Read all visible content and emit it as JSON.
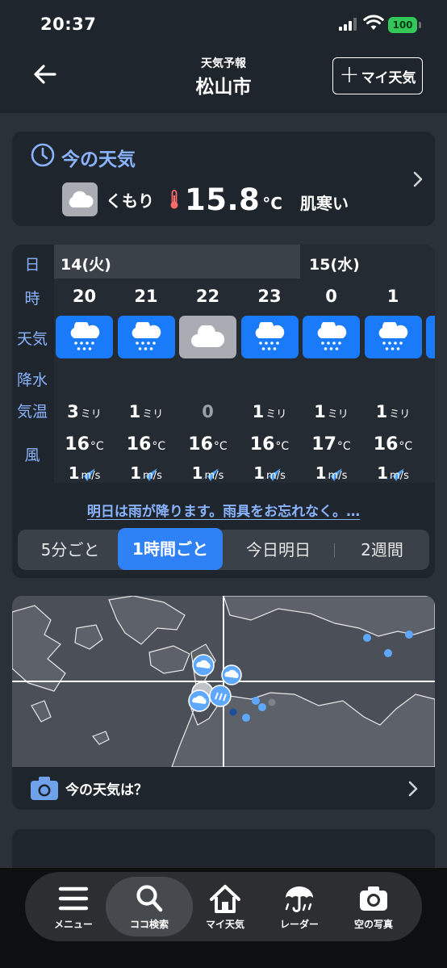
{
  "status": {
    "time": "20:37",
    "battery": "100"
  },
  "header": {
    "subtitle": "天気予報",
    "title": "松山市",
    "my_weather": "マイ天気"
  },
  "current": {
    "title": "今の天気",
    "condition": "くもり",
    "temp": "15.8",
    "unit": "°C",
    "feeling": "肌寒い"
  },
  "hourly": {
    "row_labels": {
      "day": "日",
      "hour": "時",
      "weather": "天気",
      "precip": "降水",
      "temp": "気温",
      "wind": "風"
    },
    "dates": [
      "14(火)",
      "15(水)"
    ],
    "hours": [
      {
        "hour": "20",
        "icon": "rain",
        "precip": "3",
        "precip_unit": "ミリ",
        "temp": "16",
        "temp_unit": "°C",
        "wind": "1",
        "wind_unit": "m/s"
      },
      {
        "hour": "21",
        "icon": "rain",
        "precip": "1",
        "precip_unit": "ミリ",
        "temp": "16",
        "temp_unit": "°C",
        "wind": "1",
        "wind_unit": "m/s"
      },
      {
        "hour": "22",
        "icon": "cloud",
        "precip": "0",
        "precip_unit": "",
        "temp": "16",
        "temp_unit": "°C",
        "wind": "1",
        "wind_unit": "m/s"
      },
      {
        "hour": "23",
        "icon": "rain",
        "precip": "1",
        "precip_unit": "ミリ",
        "temp": "16",
        "temp_unit": "°C",
        "wind": "1",
        "wind_unit": "m/s"
      },
      {
        "hour": "0",
        "icon": "rain",
        "precip": "1",
        "precip_unit": "ミリ",
        "temp": "17",
        "temp_unit": "°C",
        "wind": "1",
        "wind_unit": "m/s"
      },
      {
        "hour": "1",
        "icon": "rain",
        "precip": "1",
        "precip_unit": "ミリ",
        "temp": "16",
        "temp_unit": "°C",
        "wind": "1",
        "wind_unit": "m/s"
      }
    ],
    "notice": "明日は雨が降ります。雨具をお忘れなく。…",
    "segments": [
      "5分ごと",
      "1時間ごと",
      "今日明日",
      "2週間"
    ],
    "active_segment": "1時間ごと"
  },
  "radar": {
    "prompt": "今の天気は？"
  },
  "nav": [
    "メニュー",
    "ココ検索",
    "マイ天気",
    "レーダー",
    "空の写真"
  ],
  "colors": {
    "accent": "#8ab4ff",
    "rain_tile": "#1a7bfa",
    "cloud_tile": "#a9adb3",
    "active_tab": "#2f82f5",
    "wind_arrow": "#4aa3ff"
  }
}
